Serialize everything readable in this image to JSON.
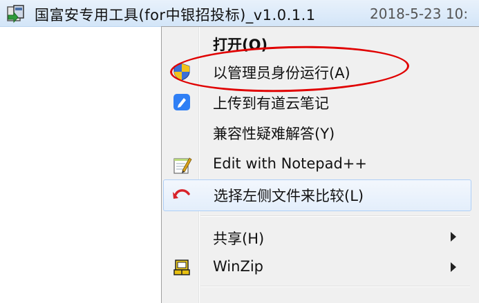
{
  "file": {
    "name": "国富安专用工具(for中银招投标)_v1.0.1.1",
    "date": "2018-5-23 10:"
  },
  "menu": {
    "items": [
      {
        "label": "打开(O)",
        "icon": null
      },
      {
        "label": "以管理员身份运行(A)",
        "icon": "uac-shield-icon"
      },
      {
        "label": "上传到有道云笔记",
        "icon": "youdao-note-icon"
      },
      {
        "label": "兼容性疑难解答(Y)",
        "icon": null
      },
      {
        "label": "Edit with Notepad++",
        "icon": "notepad-plus-plus-icon"
      },
      {
        "label": "选择左侧文件来比较(L)",
        "icon": "compare-undo-icon"
      },
      {
        "label": "共享(H)",
        "icon": null,
        "submenu": true
      },
      {
        "label": "WinZip",
        "icon": "winzip-icon",
        "submenu": true
      }
    ]
  },
  "colors": {
    "highlight_ellipse": "#e00000",
    "hover_border": "#aecff7",
    "menu_bg": "#f0f0f0"
  }
}
